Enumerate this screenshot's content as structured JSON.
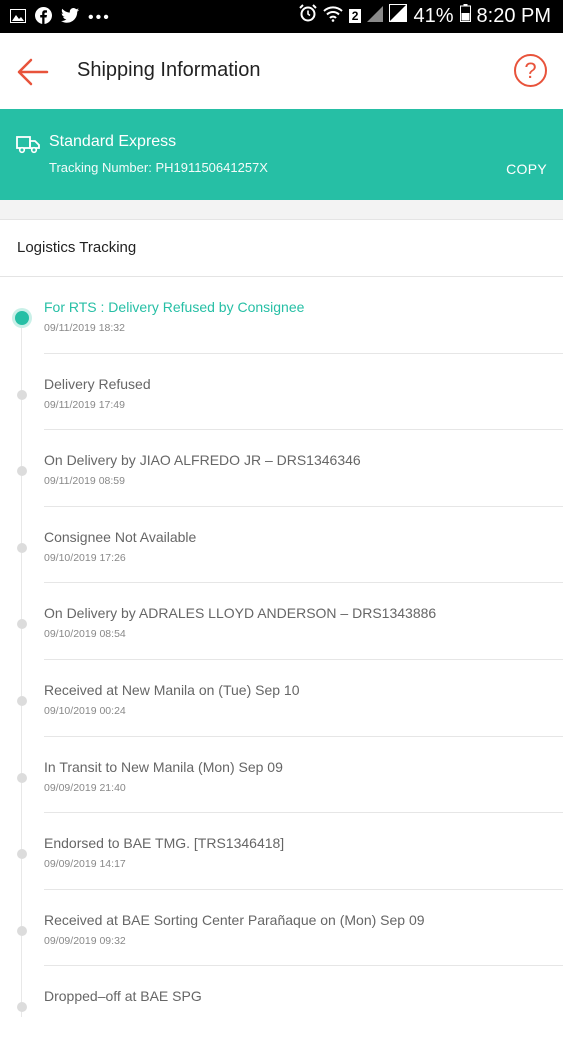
{
  "status_bar": {
    "battery": "41%",
    "time": "8:20 PM",
    "sim_badge": "2"
  },
  "header": {
    "title": "Shipping Information",
    "help_symbol": "?"
  },
  "shipping": {
    "method": "Standard Express",
    "tracking_label": "Tracking Number: PH191150641257X",
    "copy_label": "COPY"
  },
  "logistics": {
    "title": "Logistics Tracking",
    "events": [
      {
        "status": "For RTS : Delivery Refused by Consignee",
        "time": "09/11/2019 18:32",
        "active": true
      },
      {
        "status": "Delivery Refused",
        "time": "09/11/2019 17:49",
        "active": false
      },
      {
        "status": "On Delivery by JIAO ALFREDO JR – DRS1346346",
        "time": "09/11/2019 08:59",
        "active": false
      },
      {
        "status": "Consignee Not Available",
        "time": "09/10/2019 17:26",
        "active": false
      },
      {
        "status": "On Delivery by ADRALES LLOYD ANDERSON – DRS1343886",
        "time": "09/10/2019 08:54",
        "active": false
      },
      {
        "status": "Received at New Manila on (Tue) Sep 10",
        "time": "09/10/2019 00:24",
        "active": false
      },
      {
        "status": "In Transit to New Manila (Mon) Sep 09",
        "time": "09/09/2019 21:40",
        "active": false
      },
      {
        "status": "Endorsed to BAE TMG. [TRS1346418]",
        "time": "09/09/2019 14:17",
        "active": false
      },
      {
        "status": "Received at BAE Sorting Center Parañaque on (Mon) Sep 09",
        "time": "09/09/2019 09:32",
        "active": false
      },
      {
        "status": "Dropped–off at BAE SPG",
        "time": "",
        "active": false
      }
    ]
  },
  "colors": {
    "accent": "#26bfa5",
    "back_arrow": "#e8533b",
    "help": "#e8533b"
  }
}
